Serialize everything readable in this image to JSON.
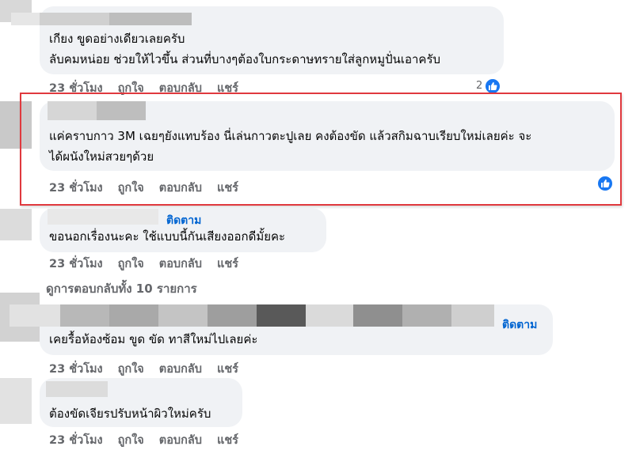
{
  "comments": [
    {
      "lines": [
        "เกียง ขูดอย่างเดียวเลยครับ",
        "ลับคมหน่อย ช่วยให้ไวขึ้น ส่วนที่บางๆต้องใบกระดาษทรายใส่ลูกหมูปั่นเอาครับ"
      ],
      "time": "23 ชั่วโมง",
      "like": "ถูกใจ",
      "reply": "ตอบกลับ",
      "share": "แชร์",
      "reaction_count": "2"
    },
    {
      "lines": [
        "แค่คราบกาว 3M เฉยๆยังแทบร้อง นี่เล่นกาวตะปูเลย คงต้องขัด แล้วสกิมฉาบเรียบใหม่เลยค่ะ จะ",
        "ได้ผนังใหม่สวยๆด้วย"
      ],
      "time": "23 ชั่วโมง",
      "like": "ถูกใจ",
      "reply": "ตอบกลับ",
      "share": "แชร์"
    },
    {
      "follow": "ติดตาม",
      "lines": [
        "ขอนอกเรื่องนะคะ ใช้แบบนี้กันเสียงออกดีมั้ยคะ"
      ],
      "time": "23 ชั่วโมง",
      "like": "ถูกใจ",
      "reply": "ตอบกลับ",
      "share": "แชร์"
    },
    {
      "follow": "ติดตาม",
      "lines": [
        "เคยรื้อห้องซ้อม ขูด ขัด ทาสีใหม่ไปเลยค่ะ"
      ],
      "time": "23 ชั่วโมง",
      "like": "ถูกใจ",
      "reply": "ตอบกลับ",
      "share": "แชร์"
    },
    {
      "lines": [
        "ต้องขัดเจียรปรับหน้าผิวใหม่ครับ"
      ],
      "time": "23 ชั่วโมง",
      "like": "ถูกใจ",
      "reply": "ตอบกลับ",
      "share": "แชร์"
    }
  ],
  "view_replies": "ดูการตอบกลับทั้ง 10 รายการ",
  "colors": {
    "bubble": "#f0f2f5",
    "like_blue": "#1877f2",
    "highlight": "#e0393e",
    "link": "#0064d1"
  },
  "icons": {
    "reaction": "like-thumb-icon"
  }
}
